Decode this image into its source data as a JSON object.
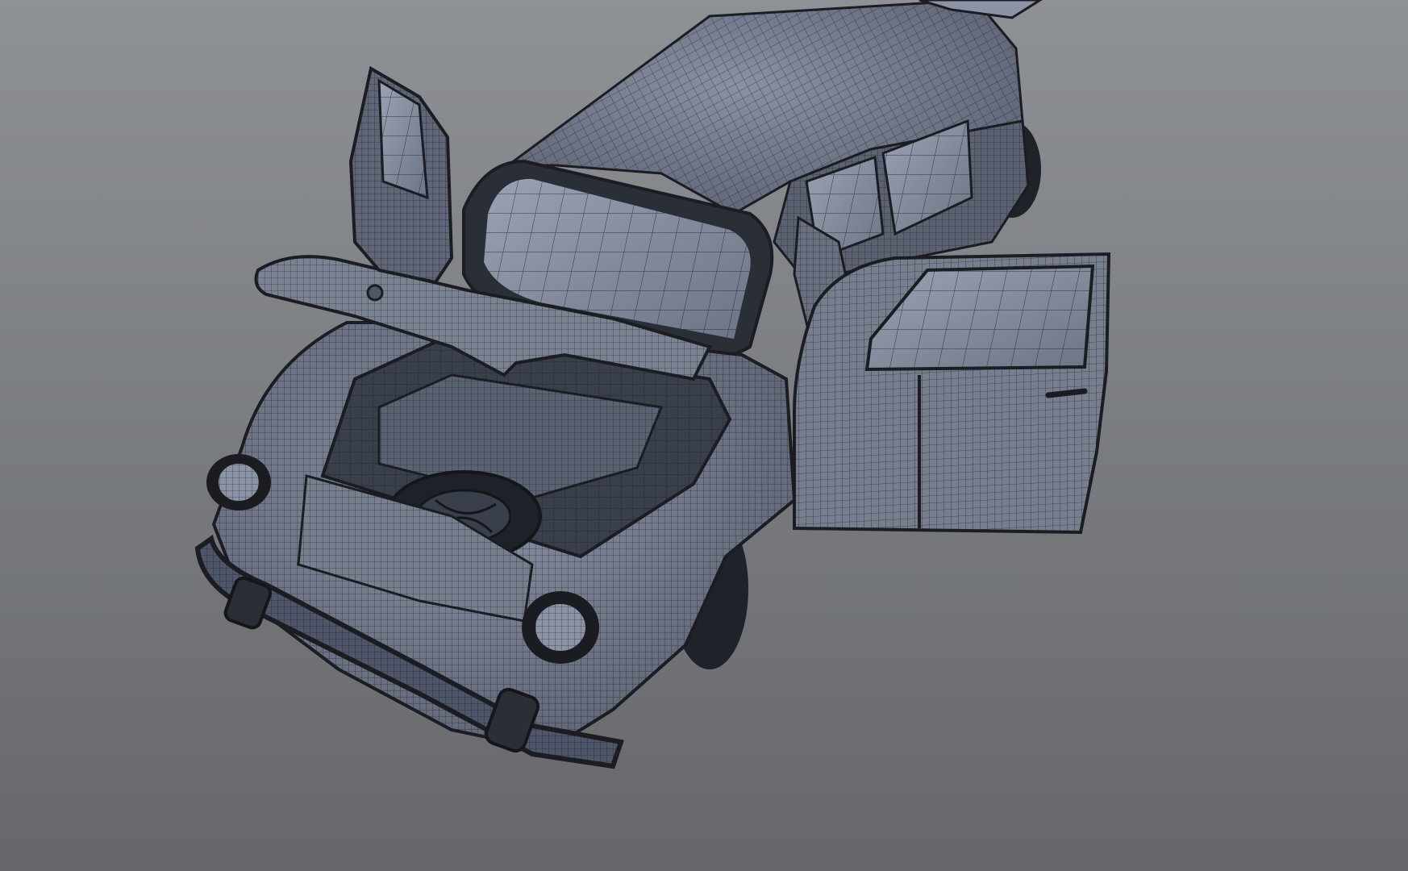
{
  "viewport": {
    "background_top": "#8e9195",
    "background_bottom": "#65676b",
    "model": {
      "subject": "car-wireframe-model",
      "surface_color": "#70778a",
      "surface_dark": "#3d4250",
      "surface_light": "#a4abbc",
      "wire_color": "#1b1d22",
      "open_parts": [
        "hood",
        "front-left-door",
        "front-right-door",
        "rear-hatch"
      ]
    }
  }
}
